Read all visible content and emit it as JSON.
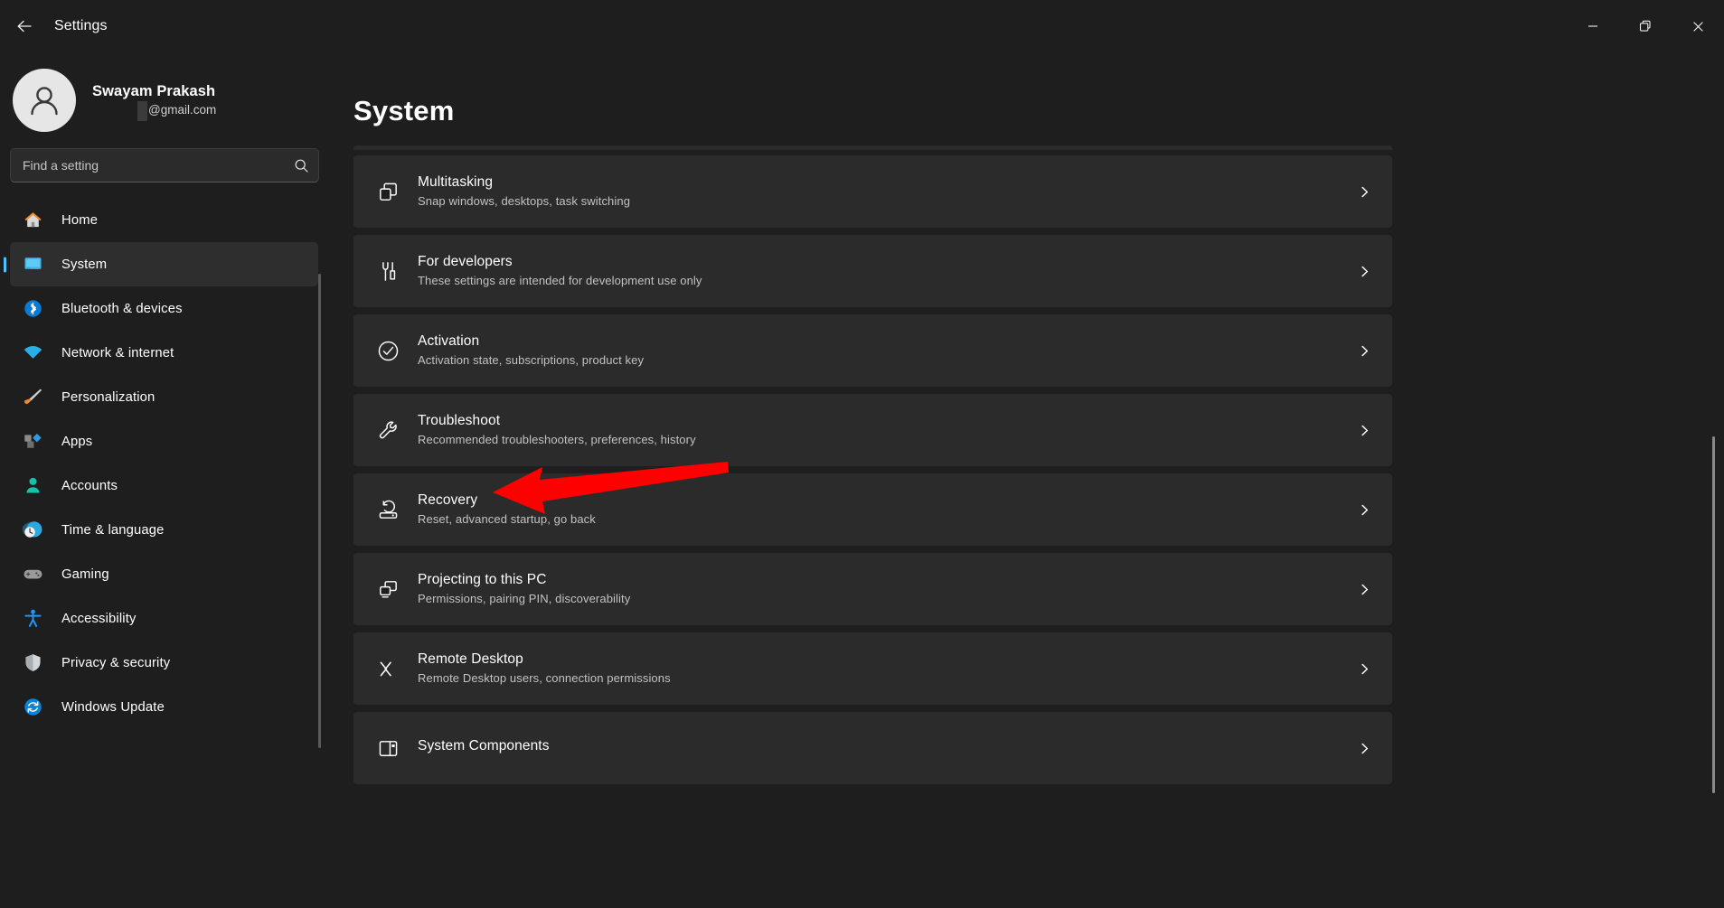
{
  "window": {
    "title": "Settings",
    "back_icon": "back-arrow-icon",
    "controls": {
      "minimize": "minimize-icon",
      "restore": "restore-icon",
      "close": "close-icon"
    }
  },
  "account": {
    "name": "Swayam Prakash",
    "email": "@gmail.com",
    "avatar_icon": "person-avatar-icon"
  },
  "search": {
    "placeholder": "Find a setting",
    "value": "",
    "icon": "search-icon"
  },
  "sidebar": {
    "items": [
      {
        "label": "Home",
        "icon": "home-icon",
        "selected": false
      },
      {
        "label": "System",
        "icon": "system-monitor-icon",
        "selected": true
      },
      {
        "label": "Bluetooth & devices",
        "icon": "bluetooth-icon",
        "selected": false
      },
      {
        "label": "Network & internet",
        "icon": "wifi-icon",
        "selected": false
      },
      {
        "label": "Personalization",
        "icon": "paintbrush-icon",
        "selected": false
      },
      {
        "label": "Apps",
        "icon": "apps-icon",
        "selected": false
      },
      {
        "label": "Accounts",
        "icon": "accounts-person-icon",
        "selected": false
      },
      {
        "label": "Time & language",
        "icon": "clock-globe-icon",
        "selected": false
      },
      {
        "label": "Gaming",
        "icon": "gamepad-icon",
        "selected": false
      },
      {
        "label": "Accessibility",
        "icon": "accessibility-person-icon",
        "selected": false
      },
      {
        "label": "Privacy & security",
        "icon": "shield-icon",
        "selected": false
      },
      {
        "label": "Windows Update",
        "icon": "update-refresh-icon",
        "selected": false
      }
    ]
  },
  "main": {
    "title": "System",
    "cards": [
      {
        "title": "Multitasking",
        "sub": "Snap windows, desktops, task switching",
        "icon": "windows-stack-icon"
      },
      {
        "title": "For developers",
        "sub": "These settings are intended for development use only",
        "icon": "tools-icon"
      },
      {
        "title": "Activation",
        "sub": "Activation state, subscriptions, product key",
        "icon": "check-circle-icon"
      },
      {
        "title": "Troubleshoot",
        "sub": "Recommended troubleshooters, preferences, history",
        "icon": "wrench-icon"
      },
      {
        "title": "Recovery",
        "sub": "Reset, advanced startup, go back",
        "icon": "recovery-drive-icon"
      },
      {
        "title": "Projecting to this PC",
        "sub": "Permissions, pairing PIN, discoverability",
        "icon": "projecting-screens-icon"
      },
      {
        "title": "Remote Desktop",
        "sub": "Remote Desktop users, connection permissions",
        "icon": "remote-desktop-icon"
      },
      {
        "title": "System Components",
        "sub": "",
        "icon": "system-components-icon"
      }
    ],
    "chevron_icon": "chevron-right-icon"
  },
  "annotation": {
    "type": "arrow",
    "color": "#fe0000",
    "points_at": "Recovery",
    "name": "red-arrow-annotation"
  },
  "colors": {
    "page_bg": "#1e1e1e",
    "card_bg": "#2b2b2b",
    "accent": "#4cc2ff",
    "selected_bg": "#2e2e2e",
    "annotation_red": "#fe0000"
  }
}
